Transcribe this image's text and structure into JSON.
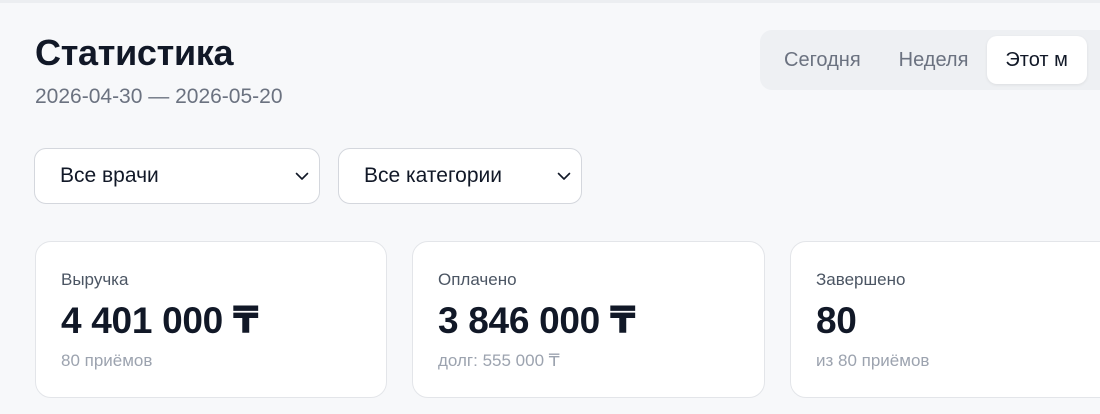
{
  "header": {
    "title": "Статистика",
    "date_range": "2026-04-30 — 2026-05-20"
  },
  "period_tabs": [
    {
      "label": "Сегодня",
      "active": false
    },
    {
      "label": "Неделя",
      "active": false
    },
    {
      "label": "Этот м",
      "active": true
    }
  ],
  "filters": {
    "doctor": {
      "value": "Все врачи",
      "icon": "chevron-down-icon"
    },
    "category": {
      "value": "Все категории",
      "icon": "chevron-down-icon"
    }
  },
  "cards": [
    {
      "label": "Выручка",
      "value": "4 401 000 ₸",
      "sub": "80 приёмов"
    },
    {
      "label": "Оплачено",
      "value": "3 846 000 ₸",
      "sub": "долг: 555 000 ₸"
    },
    {
      "label": "Завершено",
      "value": "80",
      "sub": "из 80 приёмов"
    }
  ],
  "colors": {
    "background": "#f7f8fa",
    "text_primary": "#111827",
    "text_secondary": "#6b7280",
    "text_muted": "#9ca3af",
    "card_border": "#e3e5e9",
    "tabs_background": "#eef0f3"
  }
}
